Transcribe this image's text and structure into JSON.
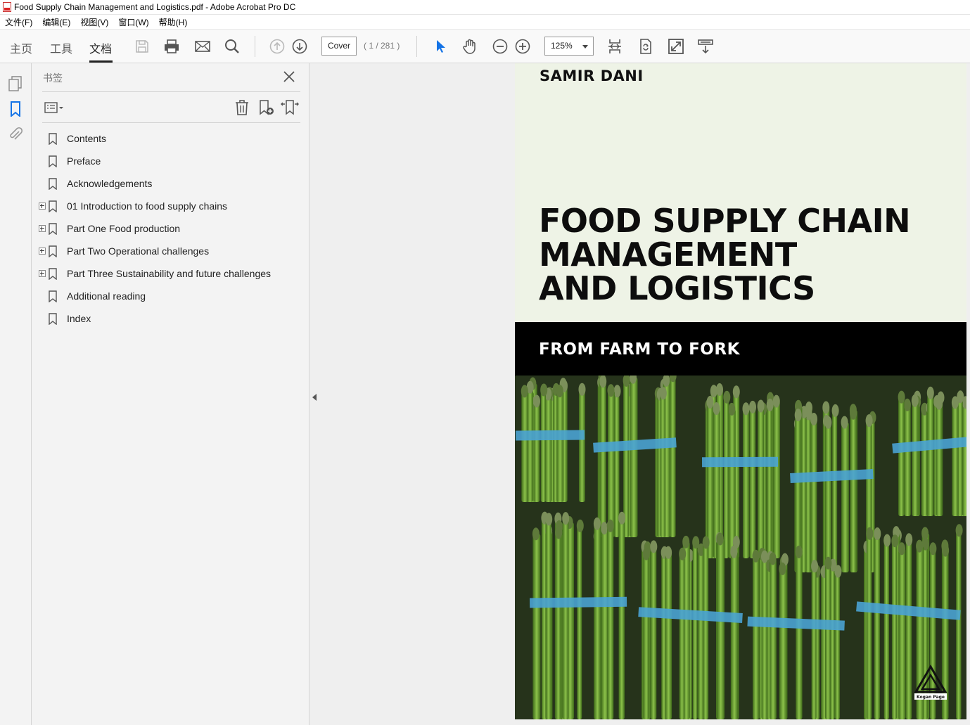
{
  "window": {
    "title": "Food Supply Chain Management and Logistics.pdf - Adobe Acrobat Pro DC"
  },
  "menu": [
    "文件(F)",
    "编辑(E)",
    "视图(V)",
    "窗口(W)",
    "帮助(H)"
  ],
  "tabs": [
    {
      "label": "主页",
      "active": false
    },
    {
      "label": "工具",
      "active": false
    },
    {
      "label": "文档",
      "active": true
    }
  ],
  "toolbar": {
    "page_label": "Cover",
    "page_count": "( 1 / 281 )",
    "zoom": "125%",
    "icons": [
      "save-icon",
      "print-icon",
      "email-icon",
      "search-icon",
      "page-up-icon",
      "page-down-icon",
      "select-cursor-icon",
      "hand-icon",
      "zoom-out-icon",
      "zoom-in-icon",
      "fit-page-icon",
      "rotate-icon",
      "full-screen-icon",
      "read-mode-icon"
    ]
  },
  "bookmarks_panel": {
    "title": "书签",
    "items": [
      {
        "label": "Contents",
        "expandable": false
      },
      {
        "label": "Preface",
        "expandable": false
      },
      {
        "label": "Acknowledgements",
        "expandable": false
      },
      {
        "label": "01 Introduction to food supply chains",
        "expandable": true
      },
      {
        "label": "Part One Food production",
        "expandable": true
      },
      {
        "label": "Part Two Operational challenges",
        "expandable": true
      },
      {
        "label": "Part Three Sustainability and future challenges",
        "expandable": true
      },
      {
        "label": "Additional reading",
        "expandable": false
      },
      {
        "label": "Index",
        "expandable": false
      }
    ]
  },
  "document": {
    "author": "SAMIR DANI",
    "title_lines": [
      "FOOD SUPPLY CHAIN",
      "MANAGEMENT",
      "AND LOGISTICS"
    ],
    "subtitle": "FROM FARM TO FORK",
    "publisher_logo": "Kogan Page"
  },
  "colors": {
    "accent_blue": "#1473e6",
    "cover_background": "#eef3e6",
    "band": "#000000"
  }
}
